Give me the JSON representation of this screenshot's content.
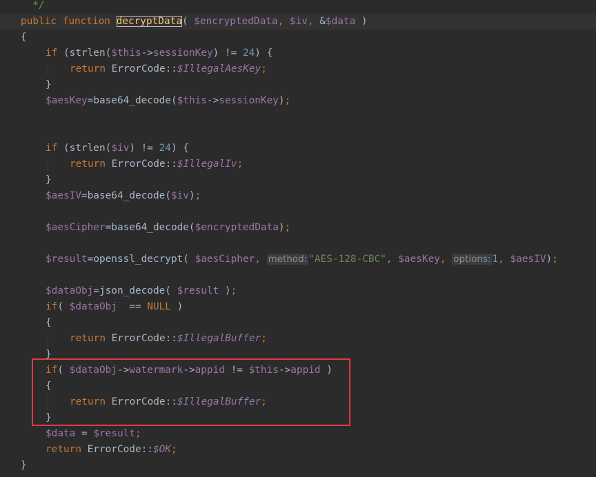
{
  "editor": {
    "lines": [
      "  */",
      "public function decryptData( $encryptedData, $iv, &$data )",
      "{",
      "if (strlen($this->sessionKey) != 24) {",
      "return ErrorCode::$IllegalAesKey;",
      "}",
      "$aesKey=base64_decode($this->sessionKey);",
      "if (strlen($iv) != 24) {",
      "return ErrorCode::$IllegalIv;",
      "}",
      "$aesIV=base64_decode($iv);",
      "$aesCipher=base64_decode($encryptedData);",
      "$result=openssl_decrypt( $aesCipher, method: \"AES-128-CBC\", $aesKey, options: 1, $aesIV);",
      "$dataObj=json_decode( $result );",
      "if( $dataObj  == NULL )",
      "{",
      "return ErrorCode::$IllegalBuffer;",
      "}",
      "if( $dataObj->watermark->appid != $this->appid )",
      "{",
      "return ErrorCode::$IllegalBuffer;",
      "}",
      "$data = $result;",
      "return ErrorCode::$OK;",
      "}"
    ],
    "parameter_hints": [
      "method:",
      "options:"
    ],
    "cursor_word": "decryptData",
    "colors": {
      "background": "#2b2b2b",
      "current_line": "#323232",
      "default_text": "#a9b7c6",
      "keyword": "#cc7832",
      "function": "#ffc66d",
      "variable": "#9876aa",
      "number": "#6897bb",
      "string": "#6a8759",
      "comment": "#629755",
      "annotation_box": "#e5393f"
    }
  }
}
